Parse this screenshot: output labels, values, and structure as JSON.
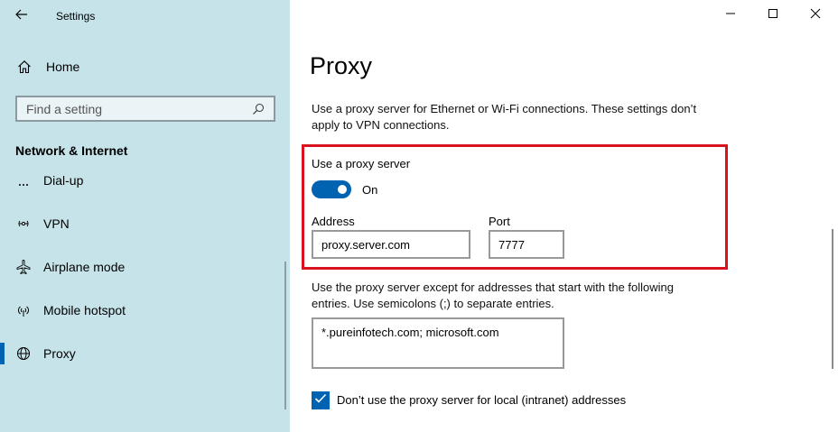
{
  "window": {
    "title": "Settings",
    "icons": {
      "back": "back-arrow-icon",
      "minimize": "minimize-icon",
      "maximize": "maximize-icon",
      "close": "close-icon"
    }
  },
  "sidebar": {
    "home_label": "Home",
    "search_placeholder": "Find a setting",
    "section_heading": "Network & Internet",
    "items": [
      {
        "label": "Dial-up",
        "icon": "dialup-icon"
      },
      {
        "label": "VPN",
        "icon": "vpn-icon"
      },
      {
        "label": "Airplane mode",
        "icon": "airplane-icon"
      },
      {
        "label": "Mobile hotspot",
        "icon": "hotspot-icon"
      },
      {
        "label": "Proxy",
        "icon": "globe-icon",
        "selected": true
      }
    ]
  },
  "main": {
    "page_title": "Proxy",
    "description": "Use a proxy server for Ethernet or Wi-Fi connections. These settings don’t apply to VPN connections.",
    "use_proxy_label": "Use a proxy server",
    "toggle_state": "On",
    "address_label": "Address",
    "address_value": "proxy.server.com",
    "port_label": "Port",
    "port_value": "7777",
    "exceptions_description": "Use the proxy server except for addresses that start with the following entries. Use semicolons (;) to separate entries.",
    "exceptions_value": "*.pureinfotech.com; microsoft.com",
    "local_checkbox_label": "Don’t use the proxy server for local (intranet) addresses",
    "local_checkbox_checked": true
  },
  "colors": {
    "sidebar_bg": "#c6e3ea",
    "accent": "#0063b1",
    "highlight_border": "#d9121f"
  }
}
